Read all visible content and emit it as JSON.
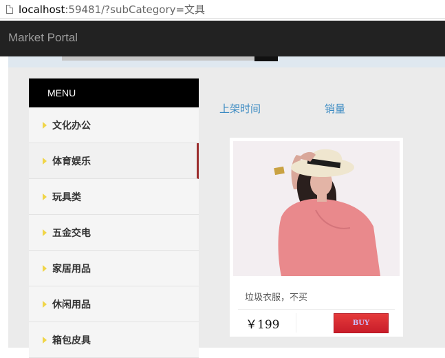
{
  "address_bar": {
    "host": "localhost",
    "rest": ":59481/?subCategory=文具"
  },
  "navbar": {
    "brand": "Market Portal"
  },
  "sidebar": {
    "header": "MENU",
    "items": [
      {
        "label": "文化办公",
        "active": false
      },
      {
        "label": "体育娱乐",
        "active": true
      },
      {
        "label": "玩具类",
        "active": false
      },
      {
        "label": "五金交电",
        "active": false
      },
      {
        "label": "家居用品",
        "active": false
      },
      {
        "label": "休闲用品",
        "active": false
      },
      {
        "label": "箱包皮具",
        "active": false
      }
    ]
  },
  "sort": {
    "by_time": "上架时间",
    "by_sales": "销量"
  },
  "product": {
    "name": "垃圾衣服，不买",
    "price": "￥199",
    "buy_label": "BUY"
  },
  "colors": {
    "navbar_bg": "#222222",
    "menu_header_bg": "#000000",
    "active_border": "#9b2d2d",
    "link": "#3a8ac2",
    "buy_button": "#d62a33"
  }
}
